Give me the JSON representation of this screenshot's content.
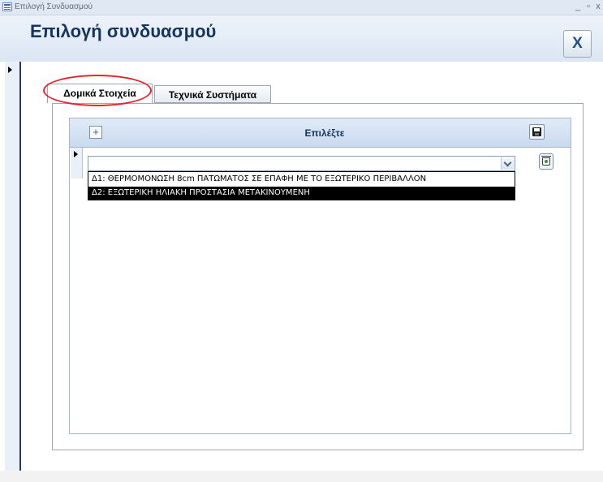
{
  "window": {
    "title": "Επιλογή Συνδυασμού",
    "minimize_label": "_",
    "maximize_label": "▫",
    "close_label": "x"
  },
  "form": {
    "title": "Επιλογή συνδυασμού",
    "close_button_label": "X"
  },
  "tabs": [
    {
      "label": "Δομικά Στοιχεία",
      "active": true,
      "highlighted": true,
      "highlight_color": "#e2262f"
    },
    {
      "label": "Τεχνικά Συστήματα",
      "active": false
    }
  ],
  "subform": {
    "heading": "Επιλέξτε",
    "add_button_label": "+",
    "combo": {
      "value": "",
      "options": [
        {
          "label": "Δ1: ΘΕΡΜΟΜΟΝΩΣΗ 8cm ΠΑΤΩΜΑΤΟΣ  ΣΕ ΕΠΑΦΗ ΜΕ ΤΟ ΕΞΩΤΕΡΙΚΟ ΠΕΡΙΒΑΛΛΟΝ",
          "selected": false
        },
        {
          "label": "Δ2: ΕΞΩΤΕΡΙΚΗ ΗΛΙΑΚΗ ΠΡΟΣΤΑΣΙΑ ΜΕΤΑΚΙΝΟΥΜΕΝΗ",
          "selected": true
        }
      ]
    }
  },
  "icons": {
    "app": "form-icon",
    "add": "plus-icon",
    "save": "save-icon",
    "delete": "trash-icon",
    "dropdown": "chevron-down-icon",
    "record": "record-selector-arrow-icon"
  },
  "colors": {
    "header_gradient_top": "#eef3fa",
    "header_gradient_bottom": "#dbe6f4",
    "title_text": "#15355f",
    "selection_background": "#000000",
    "selection_text": "#ffffff"
  }
}
